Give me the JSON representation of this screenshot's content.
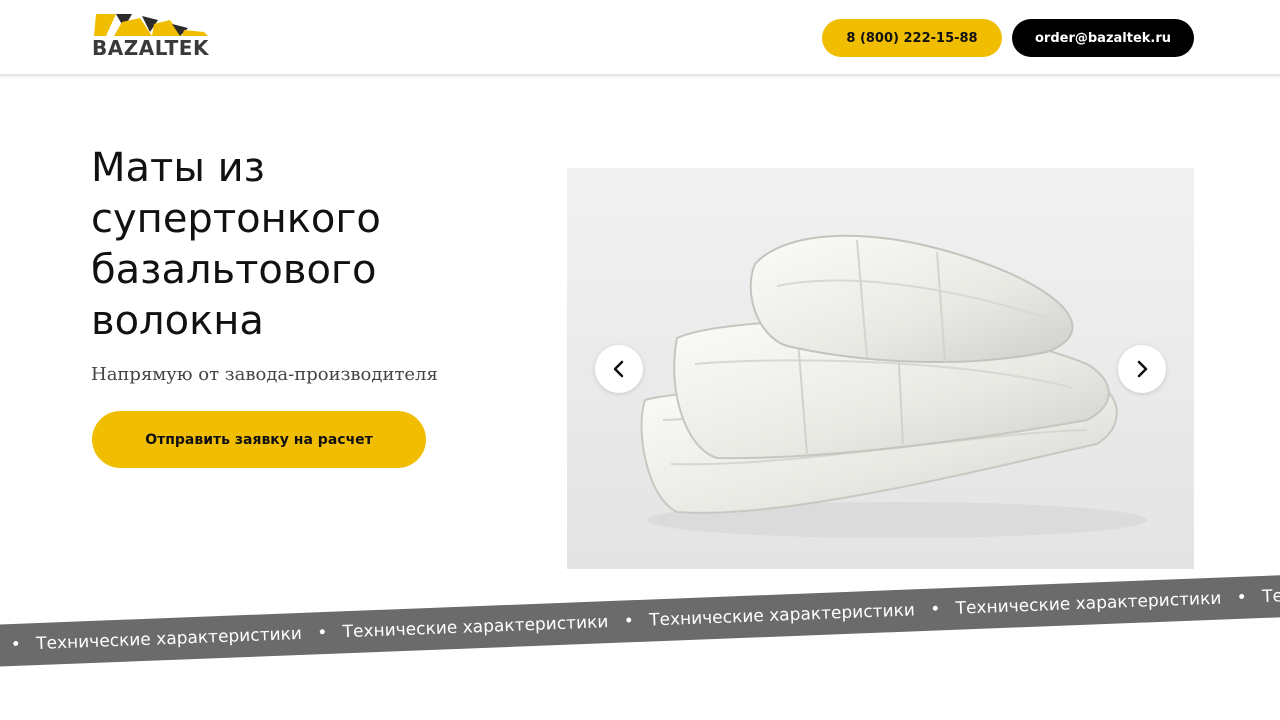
{
  "header": {
    "logo_text": "BAZALTEK",
    "phone": "8 (800) 222-15-88",
    "email": "order@bazaltek.ru"
  },
  "hero": {
    "title": "Маты из супертонкого базальтового волокна",
    "subtitle": "Напрямую от завода-производителя",
    "cta_label": "Отправить заявку на расчет"
  },
  "slider": {
    "image_alt": "mats-stack-image",
    "prev_icon": "chevron-left-icon",
    "next_icon": "chevron-right-icon"
  },
  "ticker": {
    "items": [
      "Технические характеристики",
      "Технические характеристики",
      "Технические характеристики",
      "Технические характеристики",
      "Технические характеристики"
    ],
    "separator": "•"
  },
  "colors": {
    "accent": "#f0bd00",
    "dark": "#000000",
    "ticker_bg": "#6b6b6b"
  }
}
